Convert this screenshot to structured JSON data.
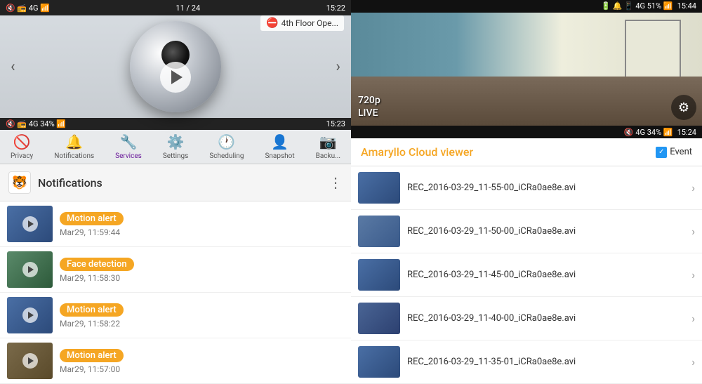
{
  "left": {
    "status_bar_1": {
      "time": "15:22",
      "counter": "11 / 24"
    },
    "camera_name": "4th Floor Ope...",
    "status_bar_2": {
      "time": "15:23"
    },
    "nav_items": [
      {
        "id": "privacy",
        "label": "Privacy",
        "icon": "🚫"
      },
      {
        "id": "notifications",
        "label": "Notifications",
        "icon": "🔔"
      },
      {
        "id": "services",
        "label": "Services",
        "icon": "⚙️"
      },
      {
        "id": "settings",
        "label": "Settings",
        "icon": "⚙️"
      },
      {
        "id": "scheduling",
        "label": "Scheduling",
        "icon": "🕐"
      },
      {
        "id": "snapshot",
        "label": "Snapshot",
        "icon": "👤"
      },
      {
        "id": "backup",
        "label": "Backu...",
        "icon": "📷"
      }
    ],
    "notifications_header": {
      "title": "Notifications",
      "more_icon": "⋮"
    },
    "notifications": [
      {
        "id": 1,
        "badge": "Motion alert",
        "badge_type": "motion",
        "time": "Mar29, 11:59:44",
        "thumb_class": "thumb-bg-1"
      },
      {
        "id": 2,
        "badge": "Face detection",
        "badge_type": "face",
        "time": "Mar29, 11:58:30",
        "thumb_class": "thumb-bg-2"
      },
      {
        "id": 3,
        "badge": "Motion alert",
        "badge_type": "motion",
        "time": "Mar29, 11:58:22",
        "thumb_class": "thumb-bg-3"
      },
      {
        "id": 4,
        "badge": "Motion alert",
        "badge_type": "motion",
        "time": "Mar29, 11:57:00",
        "thumb_class": "thumb-bg-4"
      }
    ]
  },
  "right": {
    "status_bar_1": {
      "time": "15:44"
    },
    "status_bar_2": {
      "time": "15:24"
    },
    "live_view": {
      "resolution": "720p",
      "status": "LIVE"
    },
    "cloud_viewer": {
      "title": "Amaryllo Cloud viewer",
      "event_label": "Event",
      "recordings": [
        {
          "id": 1,
          "filename": "REC_2016-03-29_11-55-00_iCRa0ae8e.avi",
          "thumb_class": "rec-thumb-1"
        },
        {
          "id": 2,
          "filename": "REC_2016-03-29_11-50-00_iCRa0ae8e.avi",
          "thumb_class": "rec-thumb-2"
        },
        {
          "id": 3,
          "filename": "REC_2016-03-29_11-45-00_iCRa0ae8e.avi",
          "thumb_class": "rec-thumb-3"
        },
        {
          "id": 4,
          "filename": "REC_2016-03-29_11-40-00_iCRa0ae8e.avi",
          "thumb_class": "rec-thumb-4"
        },
        {
          "id": 5,
          "filename": "REC_2016-03-29_11-35-01_iCRa0ae8e.avi",
          "thumb_class": "rec-thumb-5"
        }
      ]
    }
  }
}
